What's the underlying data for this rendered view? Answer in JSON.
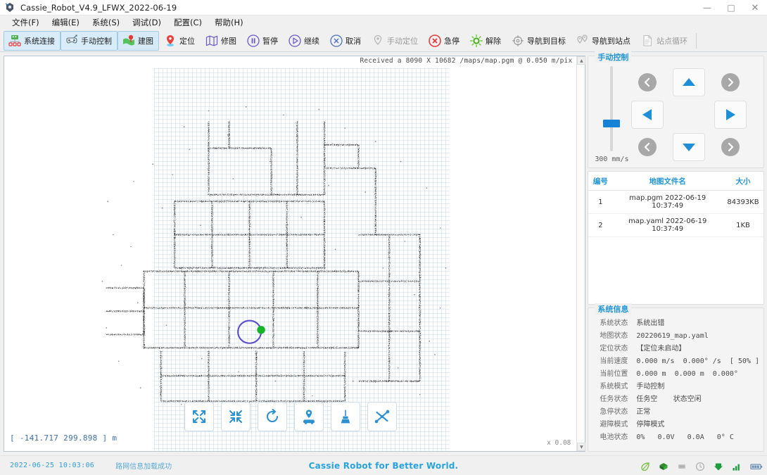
{
  "window": {
    "title": "Cassie_Robot_V4.9_LFWX_2022-06-19",
    "app_icon": "robot-icon",
    "minimize": "—",
    "maximize": "□",
    "close": "✕"
  },
  "menubar": {
    "items": [
      {
        "label": "文件(F)",
        "name": "menu-file"
      },
      {
        "label": "编辑(E)",
        "name": "menu-edit"
      },
      {
        "label": "系统(S)",
        "name": "menu-system"
      },
      {
        "label": "调试(D)",
        "name": "menu-debug"
      },
      {
        "label": "配置(C)",
        "name": "menu-config"
      },
      {
        "label": "帮助(H)",
        "name": "menu-help"
      }
    ]
  },
  "toolbar": {
    "buttons": [
      {
        "label": "系统连接",
        "icon": "network-icon",
        "state": "selected"
      },
      {
        "label": "手动控制",
        "icon": "gamepad-icon",
        "state": "selected"
      },
      {
        "label": "建图",
        "icon": "flag-pin-icon",
        "state": "selected"
      },
      {
        "label": "定位",
        "icon": "map-pin-icon",
        "state": "normal"
      },
      {
        "label": "修图",
        "icon": "map-book-icon",
        "state": "normal"
      },
      {
        "label": "暂停",
        "icon": "pause-icon",
        "state": "normal"
      },
      {
        "label": "继续",
        "icon": "play-icon",
        "state": "normal"
      },
      {
        "label": "取消",
        "icon": "cancel-icon",
        "state": "normal"
      },
      {
        "label": "手动定位",
        "icon": "pin-gray-icon",
        "state": "disabled"
      },
      {
        "label": "急停",
        "icon": "emergency-stop-icon",
        "state": "normal"
      },
      {
        "label": "解除",
        "icon": "release-icon",
        "state": "normal"
      },
      {
        "label": "导航到目标",
        "icon": "target-icon",
        "state": "normal"
      },
      {
        "label": "导航到站点",
        "icon": "station-pin-icon",
        "state": "normal"
      },
      {
        "label": "站点循环",
        "icon": "document-icon",
        "state": "disabled"
      }
    ]
  },
  "map": {
    "received_text": "Received a 8090 X 10682 /maps/map.pgm @ 0.050 m/pix",
    "coordinates": "[ -141.717 299.898 ] m",
    "scale": "x 0.08",
    "robot_marker": {
      "circle_color": "#5a4fcf",
      "dot_color": "#18b52a"
    },
    "tools": [
      {
        "name": "zoom-expand-icon",
        "label": ""
      },
      {
        "name": "zoom-collapse-icon",
        "label": ""
      },
      {
        "name": "rotate-reset-icon",
        "label": ""
      },
      {
        "name": "set-pose-car-icon",
        "label": ""
      },
      {
        "name": "eraser-broom-icon",
        "label": ""
      },
      {
        "name": "path-edit-icon",
        "label": ""
      }
    ]
  },
  "manual_control": {
    "title": "手动控制",
    "speed_label": "300 mm/s",
    "buttons": {
      "up_left": "◀",
      "up": "▲",
      "up_right": "▶",
      "left": "◀",
      "right": "▶",
      "down_left": "◀",
      "down": "▼",
      "down_right": "▶"
    }
  },
  "map_table": {
    "headers": [
      "编号",
      "地图文件名",
      "大小"
    ],
    "rows": [
      {
        "no": "1",
        "file": "map.pgm  2022-06-19 10:37:49",
        "size": "84393KB"
      },
      {
        "no": "2",
        "file": "map.yaml  2022-06-19 10:37:49",
        "size": "1KB"
      }
    ]
  },
  "system_info": {
    "title": "系统信息",
    "rows": [
      {
        "key": "系统状态",
        "value": "系统出错",
        "mono": false
      },
      {
        "key": "地图状态",
        "value": "20220619_map.yaml",
        "mono": true
      },
      {
        "key": "定位状态",
        "value": "【定位未启动】",
        "mono": false
      },
      {
        "key": "当前速度",
        "value": "0.000 m/s  0.000° /s  [ 50% ]",
        "mono": true
      },
      {
        "key": "当前位置",
        "value": "0.000 m  0.000 m  0.000°",
        "mono": true
      },
      {
        "key": "系统模式",
        "value": "手动控制",
        "mono": false
      },
      {
        "key": "任务状态",
        "value": "任务空       状态空闲",
        "mono": false
      },
      {
        "key": "急停状态",
        "value": "正常",
        "mono": false
      },
      {
        "key": "避障模式",
        "value": "停障模式",
        "mono": false
      },
      {
        "key": "电池状态",
        "value": "0%   0.0V   0.0A   0° C",
        "mono": true
      }
    ]
  },
  "statusbar": {
    "time": "2022-06-25  10:03:06",
    "message": "路网信息加载成功",
    "brand": "Cassie Robot for Better World.",
    "icons": [
      {
        "name": "leaf-icon",
        "color": "#7cc24a"
      },
      {
        "name": "green-box-icon",
        "color": "#2e8b2e"
      },
      {
        "name": "gray-chip-icon",
        "color": "#b8b8b8"
      },
      {
        "name": "clock-icon",
        "color": "#b0b0b0"
      },
      {
        "name": "download-arrow-icon",
        "color": "#1f9e3e"
      },
      {
        "name": "signal-bars-icon",
        "color": "#1f9e3e"
      },
      {
        "name": "battery-icon",
        "color": "#6b8fb5"
      }
    ]
  },
  "colors": {
    "accent": "#2196d4",
    "selected_bg": "#d8ecf9",
    "panel_bg": "#f0f0f0"
  }
}
